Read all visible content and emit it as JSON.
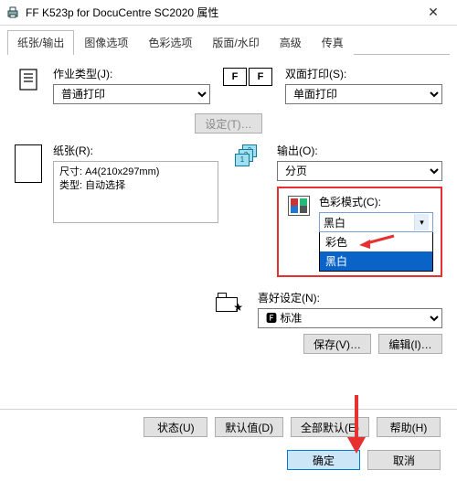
{
  "window": {
    "title": "FF K523p for DocuCentre SC2020 属性",
    "close": "✕"
  },
  "tabs": [
    "纸张/输出",
    "图像选项",
    "色彩选项",
    "版面/水印",
    "高级",
    "传真"
  ],
  "jobType": {
    "label": "作业类型(J):",
    "value": "普通打印",
    "settingsBtn": "设定(T)…"
  },
  "duplex": {
    "label": "双面打印(S):",
    "value": "单面打印"
  },
  "paper": {
    "label": "纸张(R):",
    "line1": "尺寸: A4(210x297mm)",
    "line2": "类型: 自动选择"
  },
  "output": {
    "label": "输出(O):",
    "value": "分页"
  },
  "colorMode": {
    "label": "色彩模式(C):",
    "selected": "黑白",
    "option1": "彩色",
    "option2": "黑白"
  },
  "preset": {
    "label": "喜好设定(N):",
    "value": "🅵 标准",
    "saveBtn": "保存(V)…",
    "editBtn": "编辑(I)…"
  },
  "footer": {
    "status": "状态(U)",
    "defaults": "默认值(D)",
    "allDefaults": "全部默认(E)",
    "help": "帮助(H)"
  },
  "actions": {
    "ok": "确定",
    "cancel": "取消"
  }
}
